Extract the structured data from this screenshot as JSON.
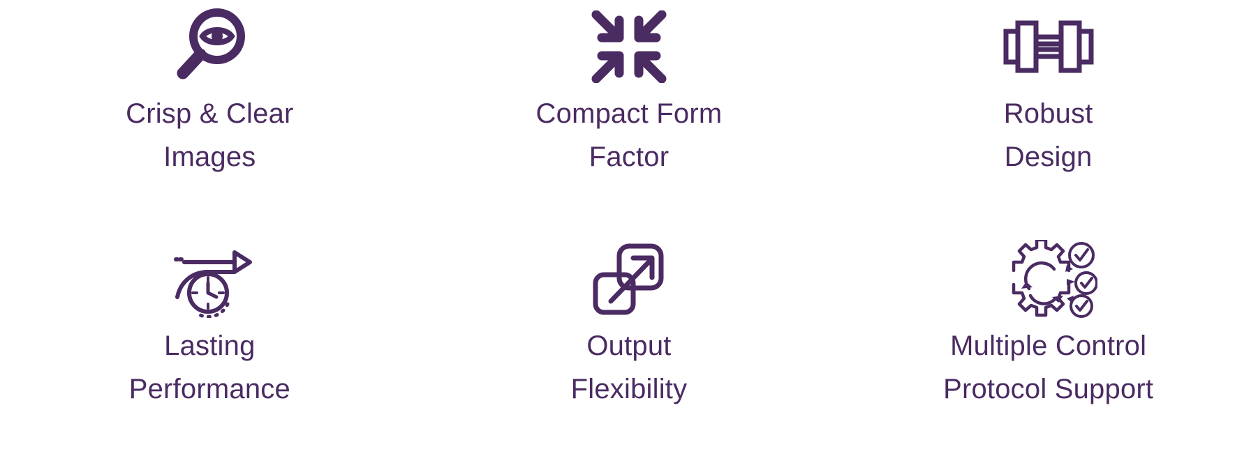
{
  "page": {
    "background_color": "#FFFFFF",
    "accent_color": "#4A2B62",
    "columns": 3,
    "rows": 2
  },
  "features": [
    {
      "icon": "magnifier-eye-icon",
      "label": "Crisp & Clear\nImages",
      "line1": "Crisp & Clear",
      "line2": "Images"
    },
    {
      "icon": "compress-arrows-icon",
      "label": "Compact Form\nFactor",
      "line1": "Compact Form",
      "line2": "Factor"
    },
    {
      "icon": "dumbbell-icon",
      "label": "Robust\nDesign",
      "line1": "Robust",
      "line2": "Design"
    },
    {
      "icon": "clock-arrow-icon",
      "label": "Lasting\nPerformance",
      "line1": "Lasting",
      "line2": "Performance"
    },
    {
      "icon": "expand-square-arrow-icon",
      "label": "Output\nFlexibility",
      "line1": "Output",
      "line2": "Flexibility"
    },
    {
      "icon": "gear-checkmarks-icon",
      "label": "Multiple Control\nProtocol Support",
      "line1": "Multiple Control",
      "line2": "Protocol Support"
    }
  ]
}
